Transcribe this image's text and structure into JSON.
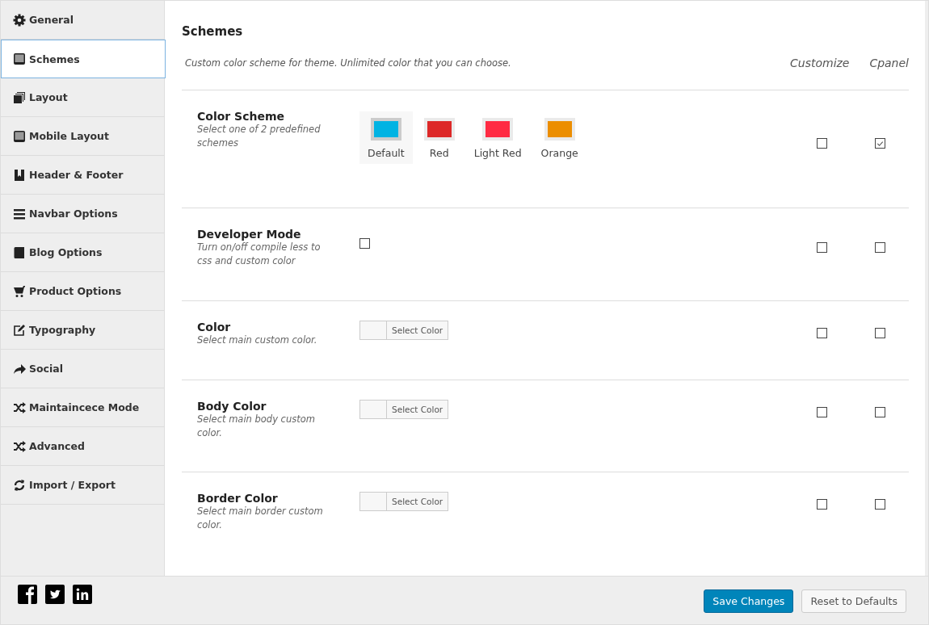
{
  "sidebar": {
    "items": [
      {
        "label": "General",
        "selected": false
      },
      {
        "label": "Schemes",
        "selected": true
      },
      {
        "label": "Layout",
        "selected": false
      },
      {
        "label": "Mobile Layout",
        "selected": false
      },
      {
        "label": "Header & Footer",
        "selected": false
      },
      {
        "label": "Navbar Options",
        "selected": false
      },
      {
        "label": "Blog Options",
        "selected": false
      },
      {
        "label": "Product Options",
        "selected": false
      },
      {
        "label": "Typography",
        "selected": false
      },
      {
        "label": "Social",
        "selected": false
      },
      {
        "label": "Maintaincece Mode",
        "selected": false
      },
      {
        "label": "Advanced",
        "selected": false
      },
      {
        "label": "Import / Export",
        "selected": false
      }
    ]
  },
  "section": {
    "title": "Schemes",
    "description": "Custom color scheme for theme. Unlimited color that you can choose.",
    "columns": [
      "Customize",
      "Cpanel"
    ]
  },
  "rows": [
    {
      "kind": "swatches",
      "title": "Color Scheme",
      "description": "Select one of 2 predefined schemes",
      "swatches": [
        {
          "label": "Default",
          "color": "#00b3e3",
          "selected": true
        },
        {
          "label": "Red",
          "color": "#dd2828",
          "selected": false
        },
        {
          "label": "Light Red",
          "color": "#ff2b43",
          "selected": false
        },
        {
          "label": "Orange",
          "color": "#ec8e00",
          "selected": false
        }
      ],
      "customize": false,
      "cpanel": true
    },
    {
      "kind": "checkbox",
      "title": "Developer Mode",
      "description": "Turn on/off compile less to css and custom color",
      "checked": false,
      "customize": false,
      "cpanel": false
    },
    {
      "kind": "color-picker",
      "title": "Color",
      "description": "Select main custom color.",
      "button": "Select Color",
      "customize": false,
      "cpanel": false
    },
    {
      "kind": "color-picker",
      "title": "Body Color",
      "description": "Select main body custom color.",
      "button": "Select Color",
      "customize": false,
      "cpanel": false
    },
    {
      "kind": "color-picker",
      "title": "Border Color",
      "description": "Select main border custom color.",
      "button": "Select Color",
      "customize": false,
      "cpanel": false
    }
  ],
  "footer": {
    "save": "Save Changes",
    "reset": "Reset to Defaults"
  }
}
